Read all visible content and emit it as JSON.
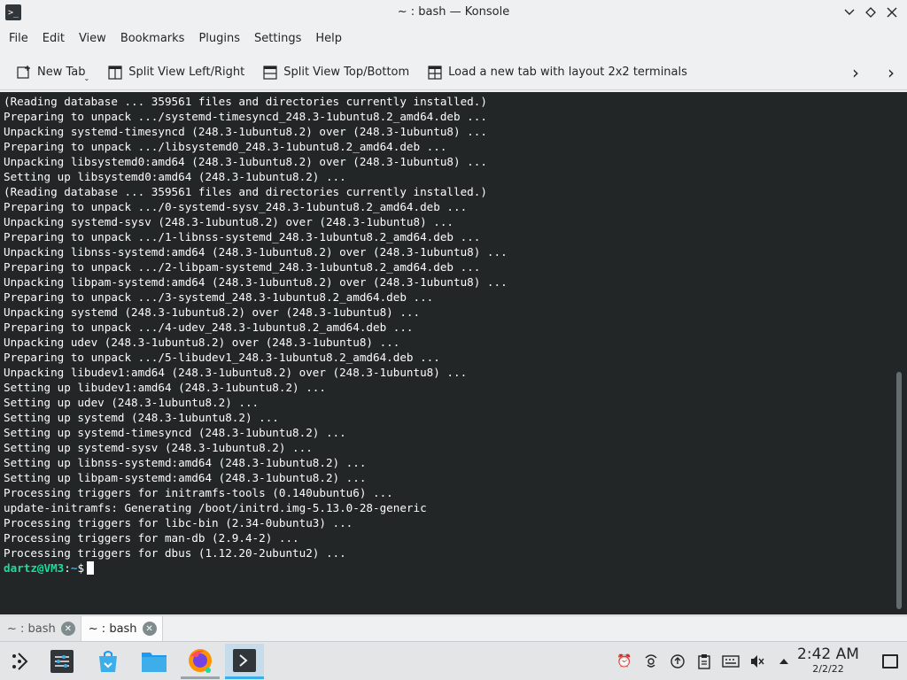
{
  "window": {
    "title": "~ : bash — Konsole",
    "app_icon": "terminal-icon",
    "controls": [
      "minimize-icon",
      "maximize-icon",
      "close-icon"
    ]
  },
  "menubar": {
    "items": [
      "File",
      "Edit",
      "View",
      "Bookmarks",
      "Plugins",
      "Settings",
      "Help"
    ]
  },
  "toolbar": {
    "new_tab": "New Tab",
    "split_lr": "Split View Left/Right",
    "split_tb": "Split View Top/Bottom",
    "layout_2x2": "Load a new tab with layout 2x2 terminals"
  },
  "terminal": {
    "lines": [
      "(Reading database ... 359561 files and directories currently installed.)",
      "Preparing to unpack .../systemd-timesyncd_248.3-1ubuntu8.2_amd64.deb ...",
      "Unpacking systemd-timesyncd (248.3-1ubuntu8.2) over (248.3-1ubuntu8) ...",
      "Preparing to unpack .../libsystemd0_248.3-1ubuntu8.2_amd64.deb ...",
      "Unpacking libsystemd0:amd64 (248.3-1ubuntu8.2) over (248.3-1ubuntu8) ...",
      "Setting up libsystemd0:amd64 (248.3-1ubuntu8.2) ...",
      "(Reading database ... 359561 files and directories currently installed.)",
      "Preparing to unpack .../0-systemd-sysv_248.3-1ubuntu8.2_amd64.deb ...",
      "Unpacking systemd-sysv (248.3-1ubuntu8.2) over (248.3-1ubuntu8) ...",
      "Preparing to unpack .../1-libnss-systemd_248.3-1ubuntu8.2_amd64.deb ...",
      "Unpacking libnss-systemd:amd64 (248.3-1ubuntu8.2) over (248.3-1ubuntu8) ...",
      "Preparing to unpack .../2-libpam-systemd_248.3-1ubuntu8.2_amd64.deb ...",
      "Unpacking libpam-systemd:amd64 (248.3-1ubuntu8.2) over (248.3-1ubuntu8) ...",
      "Preparing to unpack .../3-systemd_248.3-1ubuntu8.2_amd64.deb ...",
      "Unpacking systemd (248.3-1ubuntu8.2) over (248.3-1ubuntu8) ...",
      "Preparing to unpack .../4-udev_248.3-1ubuntu8.2_amd64.deb ...",
      "Unpacking udev (248.3-1ubuntu8.2) over (248.3-1ubuntu8) ...",
      "Preparing to unpack .../5-libudev1_248.3-1ubuntu8.2_amd64.deb ...",
      "Unpacking libudev1:amd64 (248.3-1ubuntu8.2) over (248.3-1ubuntu8) ...",
      "Setting up libudev1:amd64 (248.3-1ubuntu8.2) ...",
      "Setting up udev (248.3-1ubuntu8.2) ...",
      "Setting up systemd (248.3-1ubuntu8.2) ...",
      "Setting up systemd-timesyncd (248.3-1ubuntu8.2) ...",
      "Setting up systemd-sysv (248.3-1ubuntu8.2) ...",
      "Setting up libnss-systemd:amd64 (248.3-1ubuntu8.2) ...",
      "Setting up libpam-systemd:amd64 (248.3-1ubuntu8.2) ...",
      "Processing triggers for initramfs-tools (0.140ubuntu6) ...",
      "update-initramfs: Generating /boot/initrd.img-5.13.0-28-generic",
      "Processing triggers for libc-bin (2.34-0ubuntu3) ...",
      "Processing triggers for man-db (2.9.4-2) ...",
      "Processing triggers for dbus (1.12.20-2ubuntu2) ..."
    ],
    "prompt": {
      "user_host": "dartz@VM3",
      "separator": ":",
      "path": "~",
      "symbol": "$"
    },
    "colors": {
      "background": "#232627",
      "foreground": "#fcfcfc",
      "prompt_user": "#1cdc9a",
      "prompt_path": "#3daee9"
    }
  },
  "tabs": [
    {
      "label": "~ : bash",
      "active": false
    },
    {
      "label": "~ : bash",
      "active": true
    }
  ],
  "taskbar": {
    "launcher_icon": "application-launcher-icon",
    "tasks": [
      "system-settings-icon",
      "discover-store-icon",
      "file-manager-icon",
      "firefox-icon",
      "konsole-icon"
    ],
    "tray": [
      "alarm-clock-icon",
      "network-icon",
      "updates-icon",
      "clipboard-icon",
      "keyboard-icon",
      "volume-muted-icon",
      "expand-tray-icon"
    ],
    "clock_time": "2:42 AM",
    "clock_date": "2/2/22"
  }
}
